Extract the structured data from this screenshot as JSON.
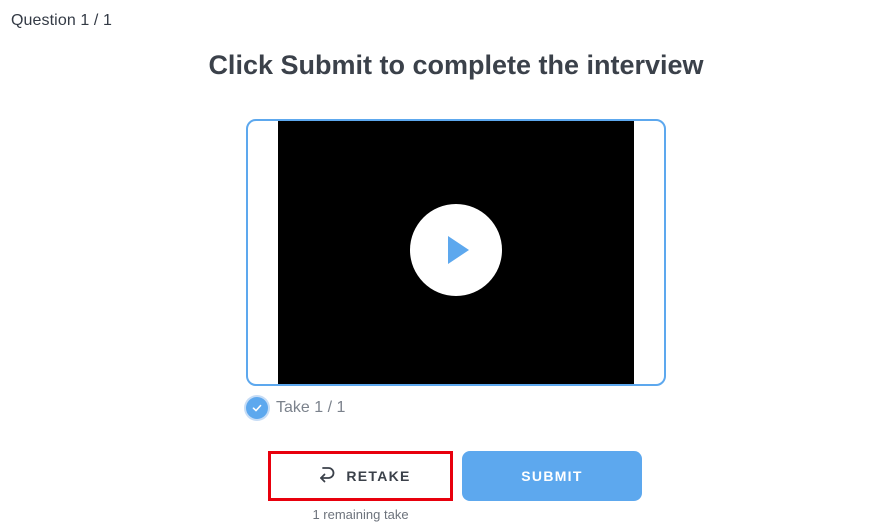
{
  "header": {
    "question_counter": "Question 1 / 1"
  },
  "main": {
    "title": "Click Submit to complete the interview"
  },
  "video": {
    "play_icon": "play-icon"
  },
  "take": {
    "label": "Take 1 / 1",
    "selected": true,
    "check_icon": "check-icon"
  },
  "actions": {
    "retake_label": "RETAKE",
    "retake_icon": "retake-arrow-icon",
    "submit_label": "SUBMIT",
    "remaining_takes": "1 remaining take"
  },
  "colors": {
    "accent": "#5da8ee",
    "highlight_border": "#e8000d",
    "title_text": "#3b414a",
    "video_background": "#000000"
  }
}
